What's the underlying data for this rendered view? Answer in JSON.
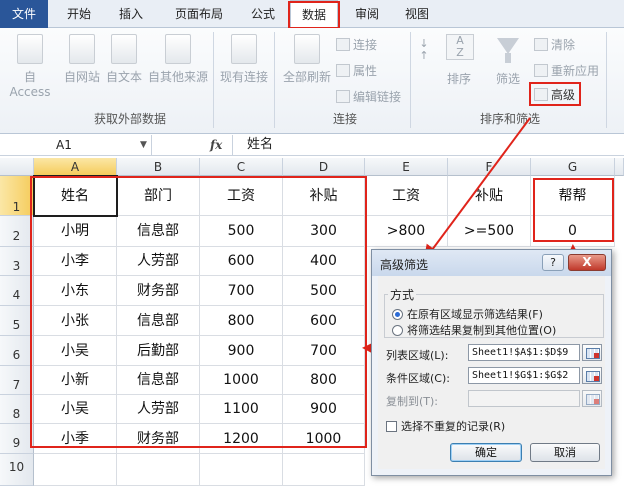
{
  "tabs": [
    "文件",
    "开始",
    "插入",
    "页面布局",
    "公式",
    "数据",
    "审阅",
    "视图"
  ],
  "ribbon": {
    "get_external": {
      "label": "获取外部数据",
      "buttons": [
        "自 Access",
        "自网站",
        "自文本",
        "自其他来源"
      ]
    },
    "existing": "现有连接",
    "refresh_all": "全部刷新",
    "connections": {
      "label": "连接",
      "items": [
        "连接",
        "属性",
        "编辑链接"
      ]
    },
    "sort_filter": {
      "label": "排序和筛选",
      "sort": "排序",
      "filter": "筛选",
      "clear": "清除",
      "reapply": "重新应用",
      "advanced": "高级",
      "az_top": "A",
      "az_bottom": "Z"
    }
  },
  "formula_bar": {
    "name_box": "A1",
    "fx": "fx",
    "content": "姓名"
  },
  "columns": [
    "A",
    "B",
    "C",
    "D",
    "E",
    "F",
    "G"
  ],
  "rows": [
    "1",
    "2",
    "3",
    "4",
    "5",
    "6",
    "7",
    "8",
    "9",
    "10"
  ],
  "table": [
    [
      "姓名",
      "部门",
      "工资",
      "补贴"
    ],
    [
      "小明",
      "信息部",
      "500",
      "300"
    ],
    [
      "小李",
      "人劳部",
      "600",
      "400"
    ],
    [
      "小东",
      "财务部",
      "700",
      "500"
    ],
    [
      "小张",
      "信息部",
      "800",
      "600"
    ],
    [
      "小吴",
      "后勤部",
      "900",
      "700"
    ],
    [
      "小新",
      "信息部",
      "1000",
      "800"
    ],
    [
      "小吴",
      "人劳部",
      "1100",
      "900"
    ],
    [
      "小季",
      "财务部",
      "1200",
      "1000"
    ]
  ],
  "criteria": {
    "e1": "工资",
    "f1": "补贴",
    "g1": "帮帮",
    "e2": ">800",
    "f2": ">=500",
    "g2": "0"
  },
  "dialog": {
    "title": "高级筛选",
    "help": "?",
    "close": "X",
    "method_label": "方式",
    "radio_in_place": "在原有区域显示筛选结果(F)",
    "radio_copy": "将筛选结果复制到其他位置(O)",
    "list_range_label": "列表区域(L):",
    "list_range_value": "Sheet1!$A$1:$D$9",
    "criteria_range_label": "条件区域(C):",
    "criteria_range_value": "Sheet1!$G$1:$G$2",
    "copy_to_label": "复制到(T):",
    "copy_to_value": "",
    "unique_label": "选择不重复的记录(R)",
    "ok": "确定",
    "cancel": "取消"
  },
  "colors": {
    "annotation": "#e0241b",
    "file_tab": "#2a5699",
    "selected_header": "#f5cc5c"
  }
}
